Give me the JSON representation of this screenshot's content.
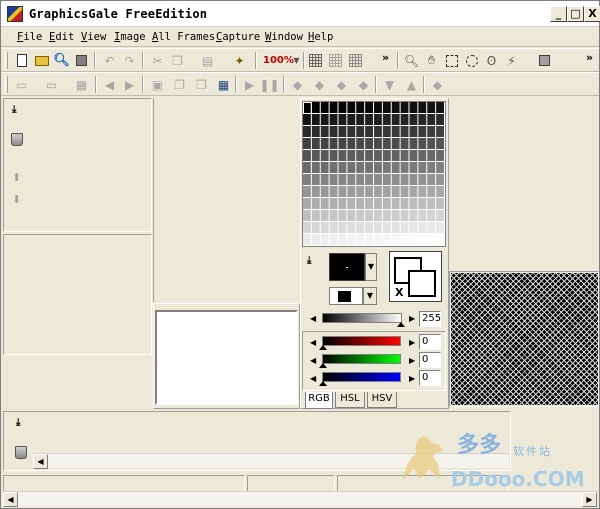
{
  "window": {
    "title": "GraphicsGale FreeEdition"
  },
  "title_buttons": {
    "minimize": "_",
    "maximize": "□",
    "close": "X"
  },
  "menu": [
    "File",
    "Edit",
    "View",
    "Image",
    "All Frames",
    "Capture",
    "Window",
    "Help"
  ],
  "toolbar1": {
    "zoom_label": "100%",
    "overflow": "»"
  },
  "toolbar2": {
    "overflow": "»"
  },
  "palette": {
    "rows": 12,
    "cols": 16
  },
  "color": {
    "foreground": "#000000",
    "background": "#ffffff",
    "swap_label": "X",
    "gray_value": "255",
    "red_value": "0",
    "green_value": "0",
    "blue_value": "0"
  },
  "tabs": [
    "RGB",
    "HSL",
    "HSV"
  ],
  "watermark": {
    "brand_cn": "多多",
    "subtitle_cn": "软件站",
    "site": "DDooo.COM"
  },
  "icons": {
    "pin": "pin-icon",
    "trash": "trash-icon",
    "up": "arrow-up-icon",
    "down": "arrow-down-icon"
  }
}
